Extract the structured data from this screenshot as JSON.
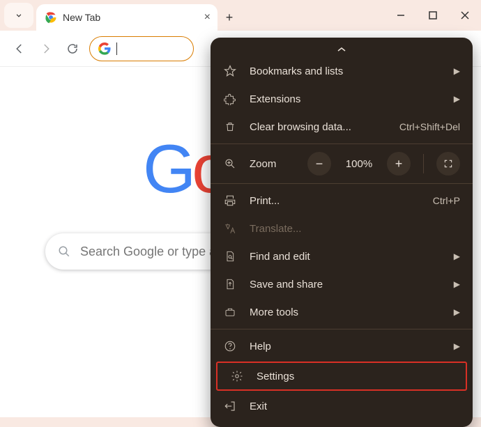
{
  "titlebar": {
    "tab_title": "New Tab",
    "newtab_plus": "+"
  },
  "omnibox": {
    "value": ""
  },
  "search": {
    "placeholder": "Search Google or type a URL"
  },
  "menu": {
    "bookmarks": "Bookmarks and lists",
    "extensions": "Extensions",
    "clear_data": "Clear browsing data...",
    "clear_data_accel": "Ctrl+Shift+Del",
    "zoom": "Zoom",
    "zoom_pct": "100%",
    "print": "Print...",
    "print_accel": "Ctrl+P",
    "translate": "Translate...",
    "find_edit": "Find and edit",
    "save_share": "Save and share",
    "more_tools": "More tools",
    "help": "Help",
    "settings": "Settings",
    "exit": "Exit"
  }
}
